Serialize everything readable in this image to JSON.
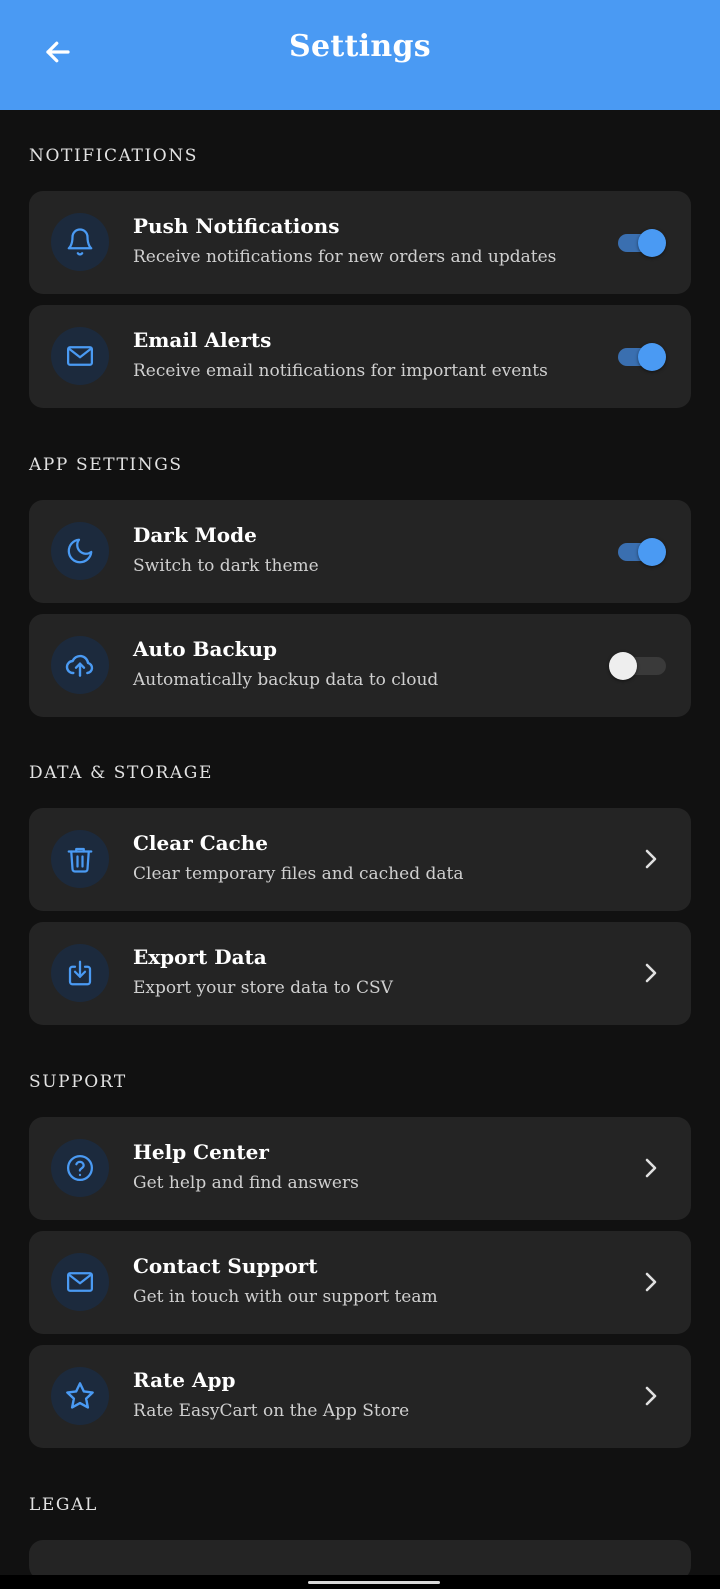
{
  "header": {
    "title": "Settings",
    "back_icon": "arrow-left-icon"
  },
  "colors": {
    "accent": "#4a9af3",
    "background": "#111111",
    "card": "#242424"
  },
  "sections": {
    "notifications": {
      "title": "NOTIFICATIONS",
      "items": [
        {
          "title": "Push Notifications",
          "subtitle": "Receive notifications for new orders and updates",
          "icon": "bell-icon",
          "control": "toggle",
          "on": true
        },
        {
          "title": "Email Alerts",
          "subtitle": "Receive email notifications for important events",
          "icon": "mail-icon",
          "control": "toggle",
          "on": true
        }
      ]
    },
    "app_settings": {
      "title": "APP SETTINGS",
      "items": [
        {
          "title": "Dark Mode",
          "subtitle": "Switch to dark theme",
          "icon": "moon-icon",
          "control": "toggle",
          "on": true
        },
        {
          "title": "Auto Backup",
          "subtitle": "Automatically backup data to cloud",
          "icon": "cloud-upload-icon",
          "control": "toggle",
          "on": false
        }
      ]
    },
    "data_storage": {
      "title": "DATA & STORAGE",
      "items": [
        {
          "title": "Clear Cache",
          "subtitle": "Clear temporary files and cached data",
          "icon": "trash-icon",
          "control": "chevron"
        },
        {
          "title": "Export Data",
          "subtitle": "Export your store data to CSV",
          "icon": "download-icon",
          "control": "chevron"
        }
      ]
    },
    "support": {
      "title": "SUPPORT",
      "items": [
        {
          "title": "Help Center",
          "subtitle": "Get help and find answers",
          "icon": "help-circle-icon",
          "control": "chevron"
        },
        {
          "title": "Contact Support",
          "subtitle": "Get in touch with our support team",
          "icon": "mail-icon",
          "control": "chevron"
        },
        {
          "title": "Rate App",
          "subtitle": "Rate EasyCart on the App Store",
          "icon": "star-icon",
          "control": "chevron"
        }
      ]
    },
    "legal": {
      "title": "LEGAL"
    }
  }
}
